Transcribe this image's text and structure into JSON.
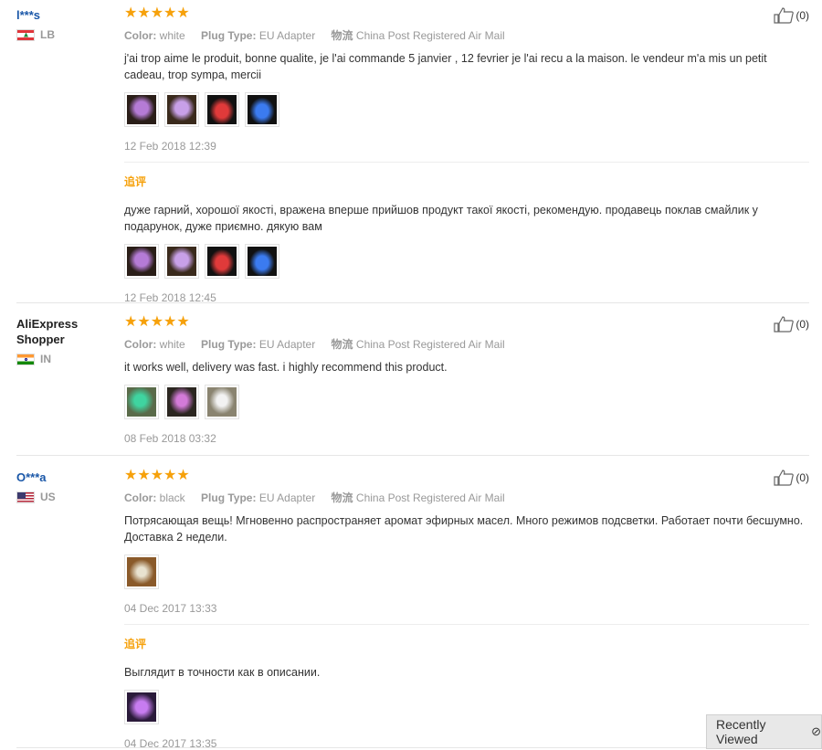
{
  "reviews": [
    {
      "user": "l***s",
      "country": "LB",
      "stars": "★★★★★",
      "attrs": {
        "color_key": "Color:",
        "color": "white",
        "plug_key": "Plug Type:",
        "plug": "EU Adapter",
        "ship_key": "物流",
        "ship": "China Post Registered Air Mail"
      },
      "text": "j'ai trop aime le produit, bonne qualite, je l'ai commande 5 janvier , 12 fevrier je l'ai recu a la maison. le vendeur m'a mis un petit cadeau, trop sympa, mercii",
      "date": "12 Feb 2018 12:39",
      "likes": "(0)",
      "followup": {
        "label": "追评",
        "text": "дуже гарний, хорошої якості, вражена вперше прийшов продукт такої якості, рекомендую. продавець поклав смайлик у подарунок, дуже приємно. дякую вам",
        "date": "12 Feb 2018 12:45"
      }
    },
    {
      "user": "AliExpress Shopper",
      "country": "IN",
      "stars": "★★★★★",
      "attrs": {
        "color_key": "Color:",
        "color": "white",
        "plug_key": "Plug Type:",
        "plug": "EU Adapter",
        "ship_key": "物流",
        "ship": "China Post Registered Air Mail"
      },
      "text": "it works well, delivery was fast. i highly recommend this product.",
      "date": "08 Feb 2018 03:32",
      "likes": "(0)"
    },
    {
      "user": "O***a",
      "country": "US",
      "stars": "★★★★★",
      "attrs": {
        "color_key": "Color:",
        "color": "black",
        "plug_key": "Plug Type:",
        "plug": "EU Adapter",
        "ship_key": "物流",
        "ship": "China Post Registered Air Mail"
      },
      "text": "Потрясающая вещь! Мгновенно распространяет аромат эфирных масел. Много режимов подсветки. Работает почти бесшумно. Доставка 2 недели.",
      "date": "04 Dec 2017 13:33",
      "likes": "(0)",
      "followup": {
        "label": "追评",
        "text": "Выглядит в точности как в описании.",
        "date": "04 Dec 2017 13:35"
      }
    }
  ],
  "recently_viewed": {
    "label": "Recently Viewed",
    "close": "⊘"
  },
  "colors": {
    "star": "#f6a10b",
    "user_link": "#1a57a8",
    "meta": "#999999"
  }
}
